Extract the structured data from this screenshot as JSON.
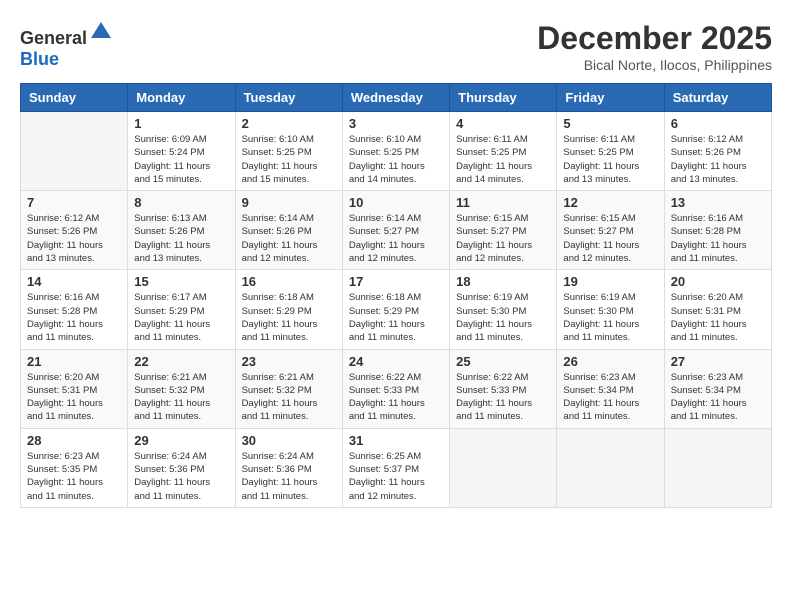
{
  "header": {
    "logo_general": "General",
    "logo_blue": "Blue",
    "month_year": "December 2025",
    "location": "Bical Norte, Ilocos, Philippines"
  },
  "weekdays": [
    "Sunday",
    "Monday",
    "Tuesday",
    "Wednesday",
    "Thursday",
    "Friday",
    "Saturday"
  ],
  "weeks": [
    [
      {
        "day": "",
        "sunrise": "",
        "sunset": "",
        "daylight": ""
      },
      {
        "day": "1",
        "sunrise": "6:09 AM",
        "sunset": "5:24 PM",
        "daylight": "11 hours and 15 minutes."
      },
      {
        "day": "2",
        "sunrise": "6:10 AM",
        "sunset": "5:25 PM",
        "daylight": "11 hours and 15 minutes."
      },
      {
        "day": "3",
        "sunrise": "6:10 AM",
        "sunset": "5:25 PM",
        "daylight": "11 hours and 14 minutes."
      },
      {
        "day": "4",
        "sunrise": "6:11 AM",
        "sunset": "5:25 PM",
        "daylight": "11 hours and 14 minutes."
      },
      {
        "day": "5",
        "sunrise": "6:11 AM",
        "sunset": "5:25 PM",
        "daylight": "11 hours and 13 minutes."
      },
      {
        "day": "6",
        "sunrise": "6:12 AM",
        "sunset": "5:26 PM",
        "daylight": "11 hours and 13 minutes."
      }
    ],
    [
      {
        "day": "7",
        "sunrise": "6:12 AM",
        "sunset": "5:26 PM",
        "daylight": "11 hours and 13 minutes."
      },
      {
        "day": "8",
        "sunrise": "6:13 AM",
        "sunset": "5:26 PM",
        "daylight": "11 hours and 13 minutes."
      },
      {
        "day": "9",
        "sunrise": "6:14 AM",
        "sunset": "5:26 PM",
        "daylight": "11 hours and 12 minutes."
      },
      {
        "day": "10",
        "sunrise": "6:14 AM",
        "sunset": "5:27 PM",
        "daylight": "11 hours and 12 minutes."
      },
      {
        "day": "11",
        "sunrise": "6:15 AM",
        "sunset": "5:27 PM",
        "daylight": "11 hours and 12 minutes."
      },
      {
        "day": "12",
        "sunrise": "6:15 AM",
        "sunset": "5:27 PM",
        "daylight": "11 hours and 12 minutes."
      },
      {
        "day": "13",
        "sunrise": "6:16 AM",
        "sunset": "5:28 PM",
        "daylight": "11 hours and 11 minutes."
      }
    ],
    [
      {
        "day": "14",
        "sunrise": "6:16 AM",
        "sunset": "5:28 PM",
        "daylight": "11 hours and 11 minutes."
      },
      {
        "day": "15",
        "sunrise": "6:17 AM",
        "sunset": "5:29 PM",
        "daylight": "11 hours and 11 minutes."
      },
      {
        "day": "16",
        "sunrise": "6:18 AM",
        "sunset": "5:29 PM",
        "daylight": "11 hours and 11 minutes."
      },
      {
        "day": "17",
        "sunrise": "6:18 AM",
        "sunset": "5:29 PM",
        "daylight": "11 hours and 11 minutes."
      },
      {
        "day": "18",
        "sunrise": "6:19 AM",
        "sunset": "5:30 PM",
        "daylight": "11 hours and 11 minutes."
      },
      {
        "day": "19",
        "sunrise": "6:19 AM",
        "sunset": "5:30 PM",
        "daylight": "11 hours and 11 minutes."
      },
      {
        "day": "20",
        "sunrise": "6:20 AM",
        "sunset": "5:31 PM",
        "daylight": "11 hours and 11 minutes."
      }
    ],
    [
      {
        "day": "21",
        "sunrise": "6:20 AM",
        "sunset": "5:31 PM",
        "daylight": "11 hours and 11 minutes."
      },
      {
        "day": "22",
        "sunrise": "6:21 AM",
        "sunset": "5:32 PM",
        "daylight": "11 hours and 11 minutes."
      },
      {
        "day": "23",
        "sunrise": "6:21 AM",
        "sunset": "5:32 PM",
        "daylight": "11 hours and 11 minutes."
      },
      {
        "day": "24",
        "sunrise": "6:22 AM",
        "sunset": "5:33 PM",
        "daylight": "11 hours and 11 minutes."
      },
      {
        "day": "25",
        "sunrise": "6:22 AM",
        "sunset": "5:33 PM",
        "daylight": "11 hours and 11 minutes."
      },
      {
        "day": "26",
        "sunrise": "6:23 AM",
        "sunset": "5:34 PM",
        "daylight": "11 hours and 11 minutes."
      },
      {
        "day": "27",
        "sunrise": "6:23 AM",
        "sunset": "5:34 PM",
        "daylight": "11 hours and 11 minutes."
      }
    ],
    [
      {
        "day": "28",
        "sunrise": "6:23 AM",
        "sunset": "5:35 PM",
        "daylight": "11 hours and 11 minutes."
      },
      {
        "day": "29",
        "sunrise": "6:24 AM",
        "sunset": "5:36 PM",
        "daylight": "11 hours and 11 minutes."
      },
      {
        "day": "30",
        "sunrise": "6:24 AM",
        "sunset": "5:36 PM",
        "daylight": "11 hours and 11 minutes."
      },
      {
        "day": "31",
        "sunrise": "6:25 AM",
        "sunset": "5:37 PM",
        "daylight": "11 hours and 12 minutes."
      },
      {
        "day": "",
        "sunrise": "",
        "sunset": "",
        "daylight": ""
      },
      {
        "day": "",
        "sunrise": "",
        "sunset": "",
        "daylight": ""
      },
      {
        "day": "",
        "sunrise": "",
        "sunset": "",
        "daylight": ""
      }
    ]
  ]
}
